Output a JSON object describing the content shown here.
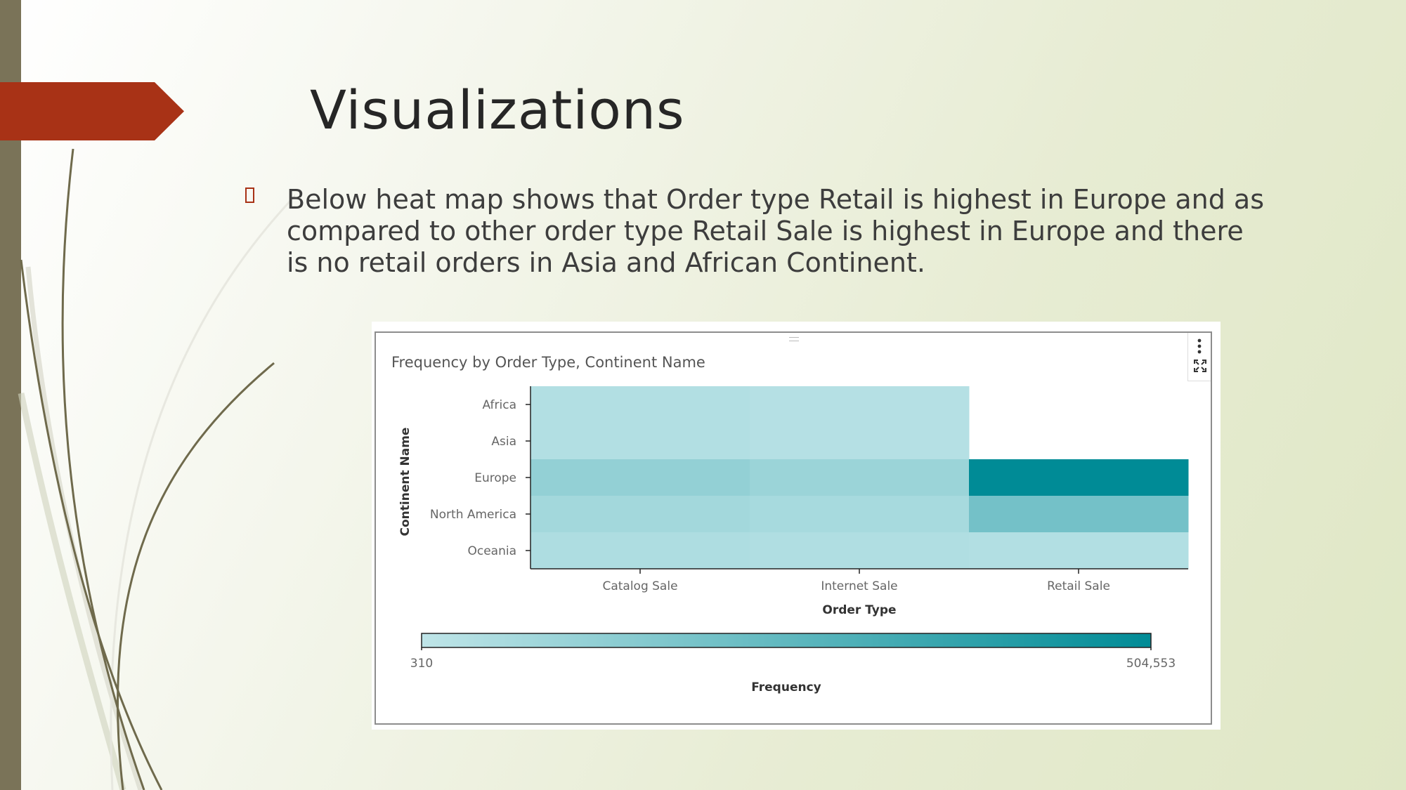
{
  "slide": {
    "title": "Visualizations",
    "body": "Below heat map shows that Order type Retail is highest in Europe and as compared to other order type Retail Sale is highest in Europe and there is no retail orders in Asia and African Continent."
  },
  "colors": {
    "accent_red": "#a83216",
    "sidebar": "#7a7358",
    "low": "#bfe5e8",
    "high": "#008b96"
  },
  "icons": {
    "menu": "kebab-menu-icon",
    "expand": "expand-icon",
    "bullet": "square-bullet-icon"
  },
  "chart_data": {
    "type": "heatmap",
    "title": "Frequency by Order Type, Continent Name",
    "xlabel": "Order Type",
    "ylabel": "Continent Name",
    "x_categories": [
      "Catalog Sale",
      "Internet Sale",
      "Retail Sale"
    ],
    "y_categories": [
      "Africa",
      "Asia",
      "Europe",
      "North America",
      "Oceania"
    ],
    "cells": [
      {
        "x": "Catalog Sale",
        "y": "Africa",
        "value": 25000
      },
      {
        "x": "Internet Sale",
        "y": "Africa",
        "value": 20000
      },
      {
        "x": "Retail Sale",
        "y": "Africa",
        "value": null
      },
      {
        "x": "Catalog Sale",
        "y": "Asia",
        "value": 25000
      },
      {
        "x": "Internet Sale",
        "y": "Asia",
        "value": 20000
      },
      {
        "x": "Retail Sale",
        "y": "Asia",
        "value": null
      },
      {
        "x": "Catalog Sale",
        "y": "Europe",
        "value": 100000
      },
      {
        "x": "Internet Sale",
        "y": "Europe",
        "value": 80000
      },
      {
        "x": "Retail Sale",
        "y": "Europe",
        "value": 504553
      },
      {
        "x": "Catalog Sale",
        "y": "North America",
        "value": 60000
      },
      {
        "x": "Internet Sale",
        "y": "North America",
        "value": 50000
      },
      {
        "x": "Retail Sale",
        "y": "North America",
        "value": 180000
      },
      {
        "x": "Catalog Sale",
        "y": "Oceania",
        "value": 35000
      },
      {
        "x": "Internet Sale",
        "y": "Oceania",
        "value": 30000
      },
      {
        "x": "Retail Sale",
        "y": "Oceania",
        "value": 25000
      }
    ],
    "color_scale": {
      "label": "Frequency",
      "min": 310,
      "max": 504553,
      "min_label": "310",
      "max_label": "504,553",
      "min_color": "#bfe5e8",
      "max_color": "#008b96"
    },
    "legend": "bottom"
  }
}
